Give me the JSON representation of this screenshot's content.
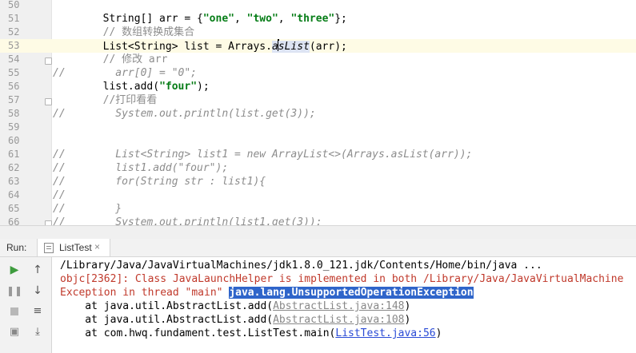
{
  "editor": {
    "lines": [
      {
        "n": "50",
        "segs": []
      },
      {
        "n": "51",
        "segs": [
          {
            "t": "        String[] arr = {",
            "c": ""
          },
          {
            "t": "\"one\"",
            "c": "str"
          },
          {
            "t": ", ",
            "c": ""
          },
          {
            "t": "\"two\"",
            "c": "str"
          },
          {
            "t": ", ",
            "c": ""
          },
          {
            "t": "\"three\"",
            "c": "str"
          },
          {
            "t": "};",
            "c": ""
          }
        ]
      },
      {
        "n": "52",
        "segs": [
          {
            "t": "        // 数组转换成集合",
            "c": "cmt"
          }
        ]
      },
      {
        "n": "53",
        "current": true,
        "segs": [
          {
            "t": "        List<String> list = Arrays.",
            "c": ""
          },
          {
            "t": "a",
            "c": "sm usage"
          },
          {
            "t": "|",
            "c": "caret"
          },
          {
            "t": "sList",
            "c": "sm usage"
          },
          {
            "t": "(arr);",
            "c": ""
          }
        ]
      },
      {
        "n": "54",
        "segs": [
          {
            "t": "        // 修改 arr",
            "c": "cmt"
          }
        ]
      },
      {
        "n": "55",
        "segs": [
          {
            "t": "//        arr[0] = \"0\";",
            "c": "cmtit"
          }
        ]
      },
      {
        "n": "56",
        "segs": [
          {
            "t": "        list.add(",
            "c": ""
          },
          {
            "t": "\"four\"",
            "c": "str"
          },
          {
            "t": ");",
            "c": ""
          }
        ]
      },
      {
        "n": "57",
        "segs": [
          {
            "t": "        //打印看看",
            "c": "cmt"
          }
        ]
      },
      {
        "n": "58",
        "segs": [
          {
            "t": "//        System.out.println(list.get(3));",
            "c": "cmtit"
          }
        ]
      },
      {
        "n": "59",
        "segs": []
      },
      {
        "n": "60",
        "segs": []
      },
      {
        "n": "61",
        "segs": [
          {
            "t": "//        List<String> list1 = new ArrayList<>(Arrays.asList(arr));",
            "c": "cmtit"
          }
        ]
      },
      {
        "n": "62",
        "segs": [
          {
            "t": "//        list1.add(\"four\");",
            "c": "cmtit"
          }
        ]
      },
      {
        "n": "63",
        "segs": [
          {
            "t": "//        for(String str : list1){",
            "c": "cmtit"
          }
        ]
      },
      {
        "n": "64",
        "segs": [
          {
            "t": "//",
            "c": "cmtit"
          }
        ]
      },
      {
        "n": "65",
        "segs": [
          {
            "t": "//        }",
            "c": "cmtit"
          }
        ]
      },
      {
        "n": "66",
        "segs": [
          {
            "t": "//        System.out.println(list1.get(3));",
            "c": "cmtit"
          }
        ]
      }
    ]
  },
  "run_panel": {
    "label": "Run:",
    "tab_label": "ListTest",
    "tab_close": "×"
  },
  "console": {
    "path_line": "/Library/Java/JavaVirtualMachines/jdk1.8.0_121.jdk/Contents/Home/bin/java ...",
    "objc_line": "objc[2362]: Class JavaLaunchHelper is implemented in both /Library/Java/JavaVirtualMachine",
    "exception_prefix": "Exception in thread \"main\" ",
    "exception_name": "java.lang.UnsupportedOperationException",
    "stack": [
      {
        "prefix": "    at java.util.AbstractList.add(",
        "link": "AbstractList.java:148",
        "suffix": ")",
        "style": "gray"
      },
      {
        "prefix": "    at java.util.AbstractList.add(",
        "link": "AbstractList.java:108",
        "suffix": ")",
        "style": "gray"
      },
      {
        "prefix": "    at com.hwq.fundament.test.ListTest.main(",
        "link": "ListTest.java:56",
        "suffix": ")",
        "style": "blue"
      }
    ]
  },
  "colors": {
    "string": "#067d17",
    "comment": "#8c8c8c",
    "error": "#c0392b",
    "exception_highlight": "#2f65ca",
    "run_green": "#3e9c3e"
  },
  "icons": [
    "run-icon",
    "rerun-up-icon",
    "pause-icon",
    "down-arrow-icon",
    "stop-icon",
    "soft-wrap-icon",
    "camera-icon",
    "scroll-end-icon",
    "close-icon"
  ]
}
